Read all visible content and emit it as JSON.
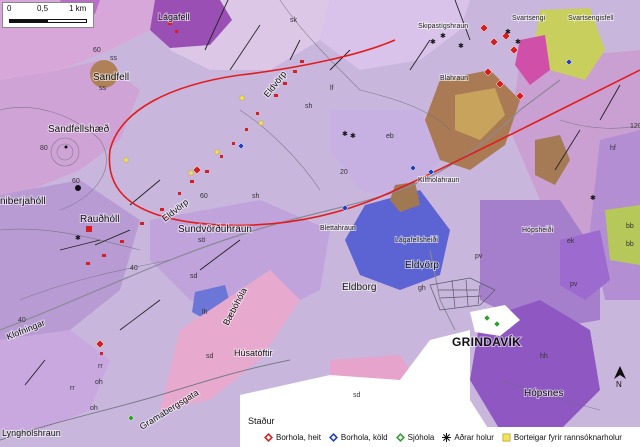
{
  "scale_bar": {
    "labels": [
      "0",
      "0,5",
      "1 km"
    ]
  },
  "legend": {
    "items": [
      {
        "label": "Borhola, heit",
        "color": "#d42020",
        "icon": "diamond-red"
      },
      {
        "label": "Borhola, köld",
        "color": "#2040c0",
        "icon": "diamond-blue"
      },
      {
        "label": "Sjóhola",
        "color": "#30a030",
        "icon": "diamond-green"
      },
      {
        "label": "Aðrar holur",
        "color": "#111111",
        "icon": "asterisk"
      },
      {
        "label": "Borteigar fyrir rannsóknarholur",
        "color": "#f2e060",
        "icon": "square-yellow"
      }
    ]
  },
  "north_arrow": {
    "label": "N"
  },
  "place_labels": {
    "lagafell": "Lágafell",
    "sandfell": "Sandfell",
    "sandfellshaed": "Sandfellshæð",
    "skipastigshraun": "Skipastígshraun",
    "svartsengi": "Svartsengi",
    "svartsengisfell": "Svartsengisfell",
    "blahraun": "Blahraun",
    "eldvorp_n": "Eldvörp",
    "eldvorp_s": "Eldvörp",
    "eldvorp_c": "Eldvörp",
    "nibergsholl": "niberjahóll",
    "raudholl": "Rauðhóll",
    "sundvordhraun": "Sundvörðuhraun",
    "eldborg": "Eldborg",
    "klofningar": "Klofningar",
    "lagafellsheidi": "Lágafellsheiði",
    "kilfholahraun": "Kílfholahraun",
    "blettahraun": "Blettahraun",
    "grindavik": "GRINDAVÍK",
    "hopsnes": "Hópsnes",
    "hopsheidi": "Hópsheiði",
    "husatoftir": "Húsatóftir",
    "baeborhofa": "Bæbóhóla",
    "stadur": "Staður",
    "lyngholshraun": "Lyngholshraun",
    "gransbergsgata": "Gramabergsgata"
  },
  "unit_labels": {
    "ss1": "ss",
    "ss2": "ss",
    "sh1": "sh",
    "sh2": "sh",
    "so": "sö",
    "sd1": "sd",
    "sd2": "sd",
    "sd3": "sd",
    "lh": "lh",
    "gh": "gh",
    "pv1": "pv",
    "pv2": "pv",
    "hh": "hh",
    "ek": "ek",
    "bb1": "bb",
    "bb2": "bb",
    "rr1": "rr",
    "rr2": "rr",
    "oh1": "oh",
    "oh2": "oh",
    "sk": "sk",
    "lf": "lf",
    "eb": "eb",
    "hf": "hf"
  },
  "contour_labels": {
    "c1": "60",
    "c2": "40",
    "c3": "60",
    "c4": "80",
    "c5": "20",
    "c6": "60",
    "c7": "40",
    "c8": "120"
  }
}
